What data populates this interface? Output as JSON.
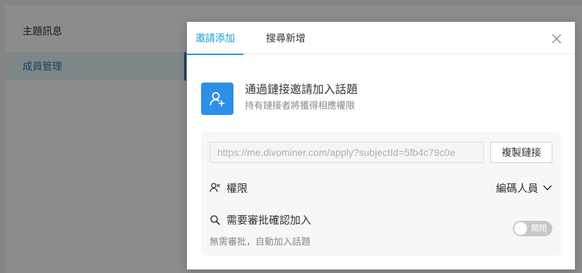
{
  "sidebar": {
    "items": [
      {
        "label": "主題訊息"
      },
      {
        "label": "成員管理"
      }
    ]
  },
  "modal": {
    "tabs": [
      {
        "label": "邀請添加"
      },
      {
        "label": "搜尋新增"
      }
    ],
    "header": {
      "title": "通過鏈接邀請加入話題",
      "subtitle": "持有鏈接者將獲得相應權限"
    },
    "link": {
      "value": "https://me.divominer.com/apply?subjectId=5fb4c79c0e"
    },
    "copy_label": "複製鏈接",
    "permission": {
      "label": "權限",
      "role": "編碼人員"
    },
    "approval": {
      "label": "需要審批確認加入",
      "description": "無需審批，自動加入話題",
      "toggle_text": "關閉"
    }
  },
  "colors": {
    "accent": "#1a9dd6",
    "icon_bg": "#2d8fe5"
  }
}
